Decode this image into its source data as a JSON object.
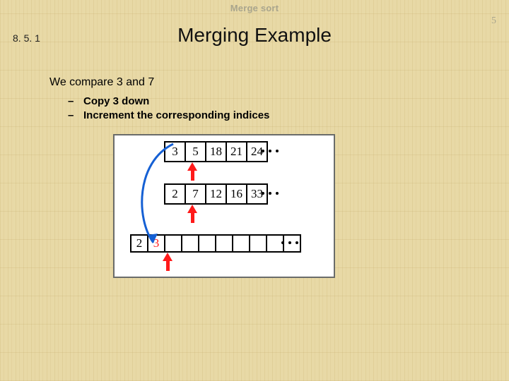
{
  "topic": "Merge sort",
  "page_number": "5",
  "section_number": "8. 5. 1",
  "title": "Merging Example",
  "lead": "We compare 3 and 7",
  "bullets": [
    "Copy 3 down",
    "Increment the corresponding indices"
  ],
  "diagram": {
    "array_a": [
      "3",
      "5",
      "18",
      "21",
      "24"
    ],
    "array_b": [
      "2",
      "7",
      "12",
      "16",
      "33"
    ],
    "merged": [
      "2",
      "3",
      "",
      "",
      "",
      "",
      "",
      "",
      "",
      ""
    ],
    "pointer_a_index": 1,
    "pointer_b_index": 1,
    "pointer_merged_index": 2
  }
}
